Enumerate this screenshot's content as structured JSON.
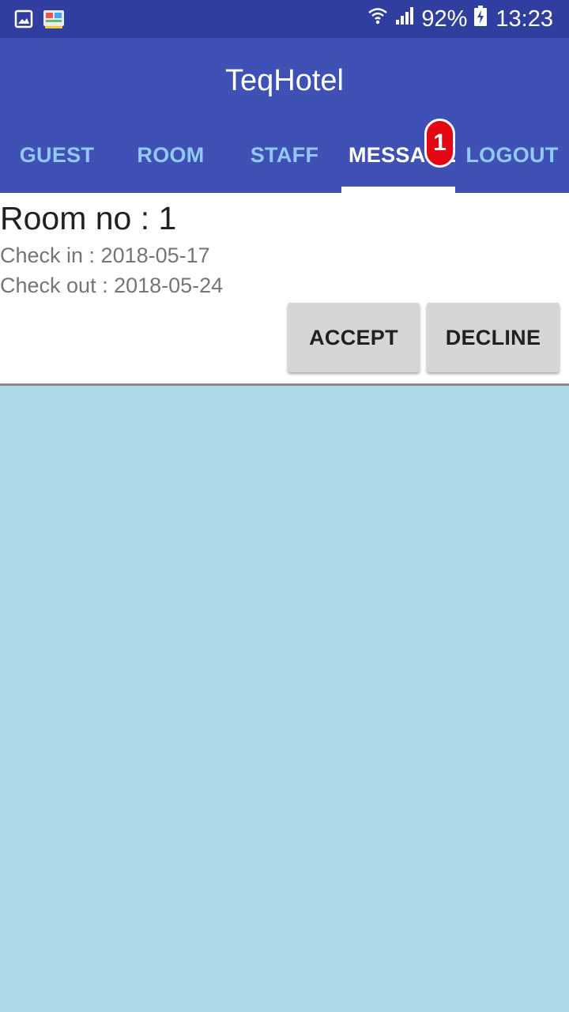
{
  "status_bar": {
    "battery": "92%",
    "time": "13:23",
    "icons": [
      "gallery-icon",
      "app-notification-icon",
      "wifi-icon",
      "signal-icon",
      "battery-charging-icon"
    ]
  },
  "app": {
    "title": "TeqHotel"
  },
  "tabs": [
    {
      "label": "GUEST",
      "active": false
    },
    {
      "label": "ROOM",
      "active": false
    },
    {
      "label": "STAFF",
      "active": false
    },
    {
      "label": "MESSAGE",
      "active": true
    },
    {
      "label": "LOGOUT",
      "active": false
    }
  ],
  "badge": {
    "count": "1"
  },
  "request": {
    "room": "Room no : 1",
    "check_in": "Check in : 2018-05-17",
    "check_out": "Check out : 2018-05-24",
    "accept_label": "ACCEPT",
    "decline_label": "DECLINE"
  },
  "colors": {
    "status_bar": "#303f9f",
    "app_bar": "#3f51b5",
    "tab_inactive": "#90caf9",
    "badge": "#e30613",
    "background": "#add8e6"
  }
}
